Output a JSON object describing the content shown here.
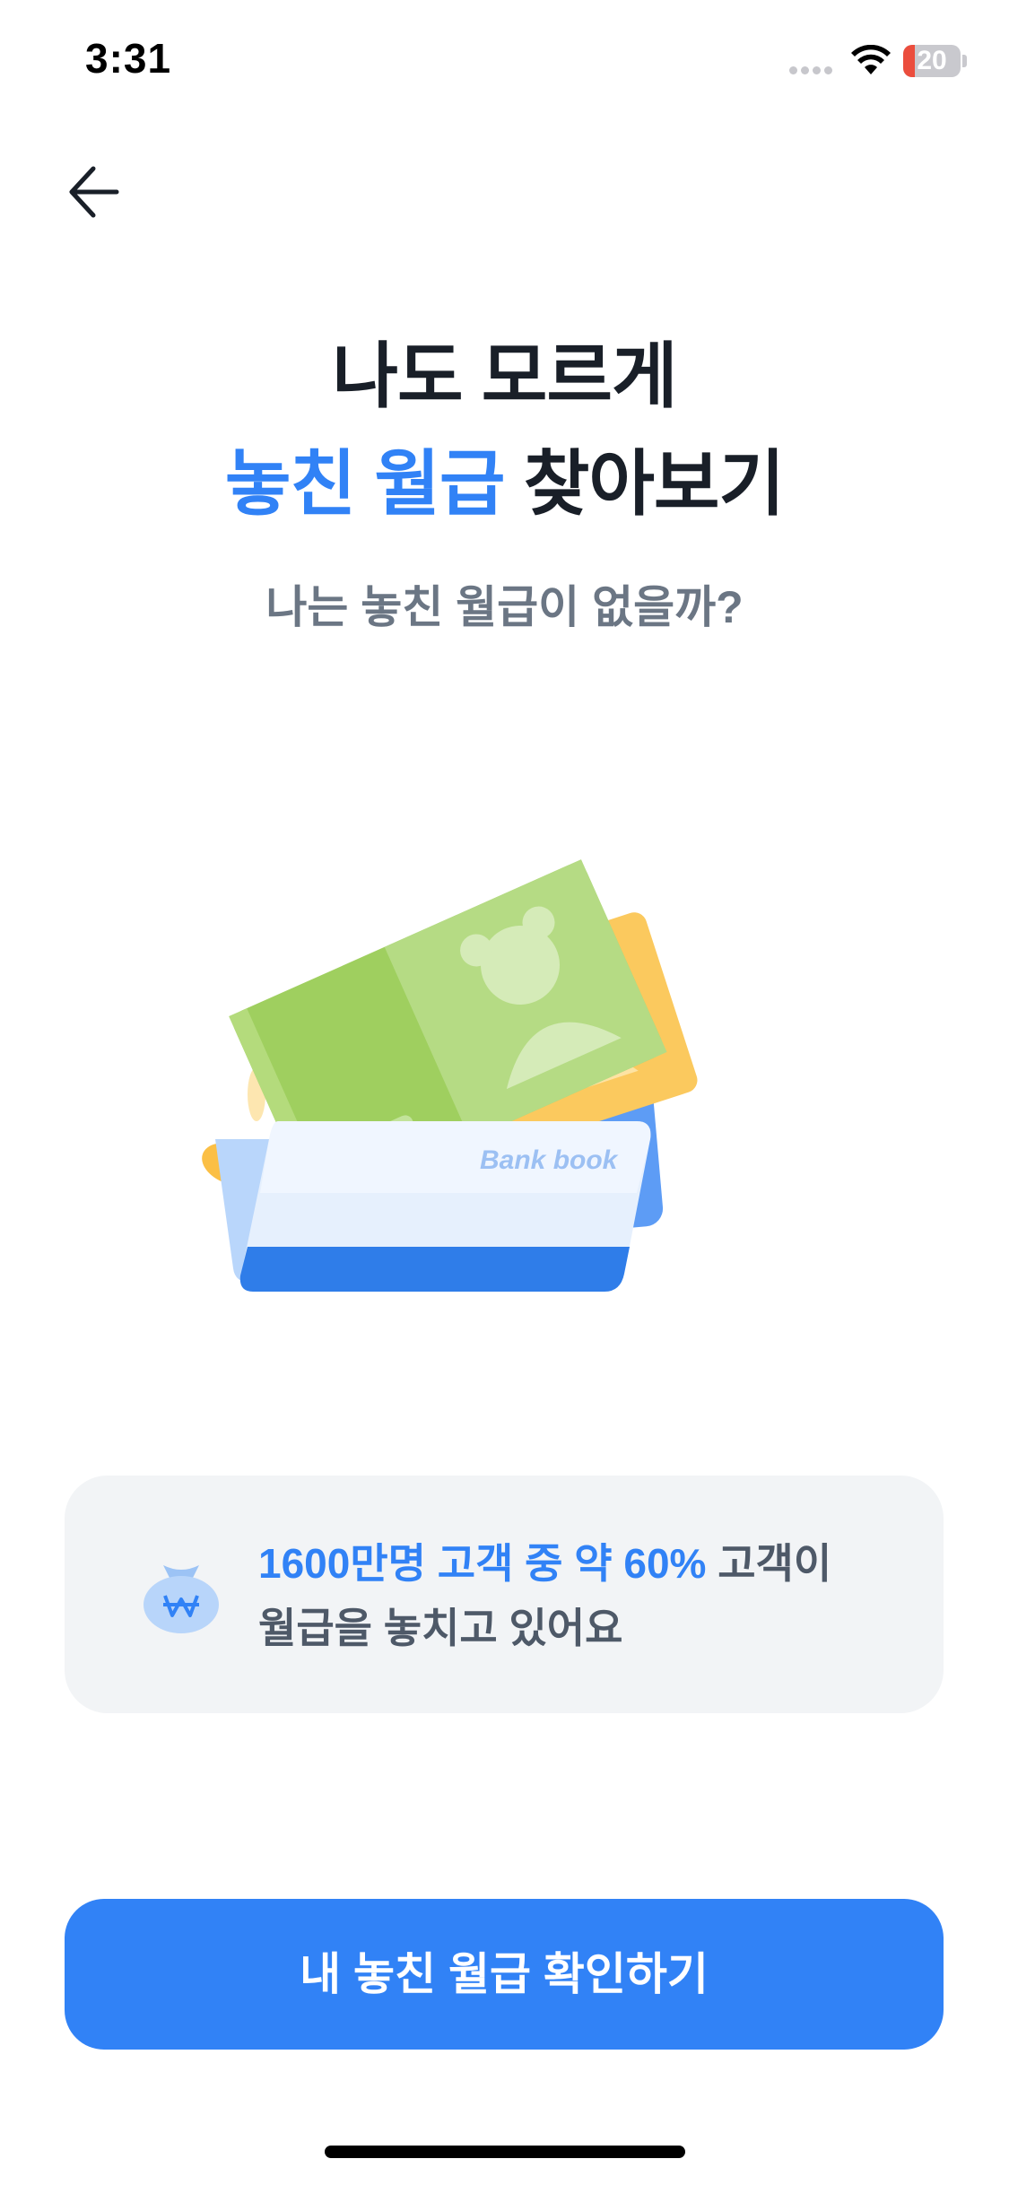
{
  "status_bar": {
    "time": "3:31",
    "battery_level": "20",
    "battery_fraction": 0.2,
    "icons": [
      "signal-dots-icon",
      "wifi-icon",
      "battery-icon"
    ]
  },
  "nav": {
    "back_icon": "arrow-left-icon"
  },
  "hero": {
    "title_line_1": "나도 모르게",
    "title_line_2_highlight": "놓친 월급",
    "title_line_2_rest": " 찾아보기",
    "subtitle": "나는 놓친 월급이 없을까?",
    "illustration_label": "Bank book"
  },
  "info_card": {
    "icon": "money-bag-won-icon",
    "highlight": "1600만명 고객 중 약 60%",
    "text_rest_line_1": " 고객이",
    "text_line_2": "월급을 놓치고 있어요"
  },
  "cta": {
    "label": "내 놓친 월급 확인하기"
  },
  "colors": {
    "accent": "#3182f6",
    "title": "#191f28",
    "subtitle": "#6b7684",
    "card_bg": "#f2f4f6",
    "battery_low": "#eb4d3d"
  }
}
